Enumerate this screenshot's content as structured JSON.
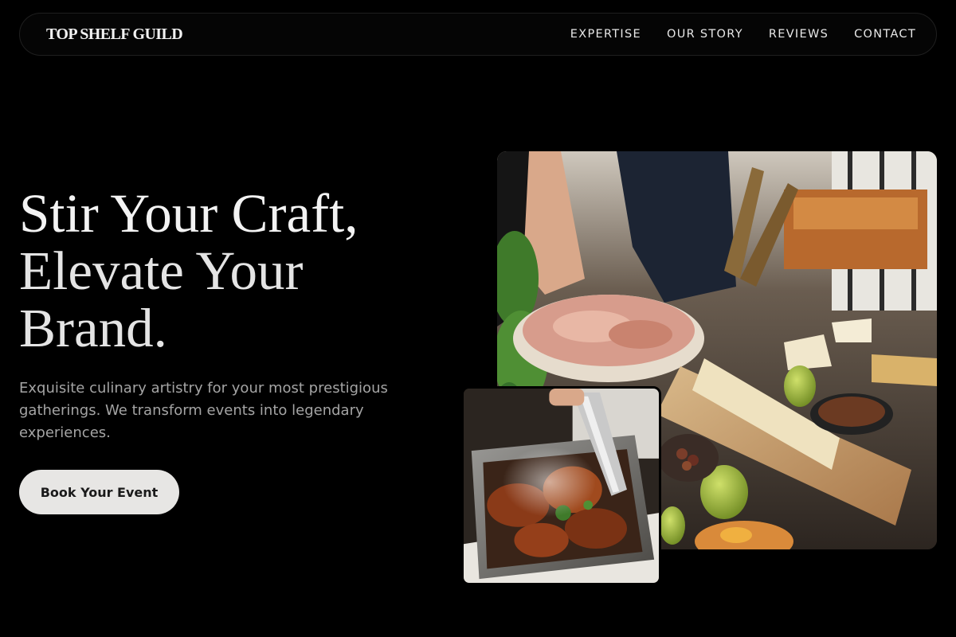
{
  "brand": "TOP SHELF GUILD",
  "nav": {
    "links": [
      "EXPERTISE",
      "OUR STORY",
      "REVIEWS",
      "CONTACT"
    ]
  },
  "hero": {
    "title_lines": [
      "Stir Your Craft,",
      "Elevate Your",
      "Brand."
    ],
    "subtitle": "Exquisite culinary artistry for your most prestigious gatherings. We transform events into legendary experiences.",
    "cta_label": "Book Your Event"
  },
  "images": {
    "main": "catering-spread-photo",
    "secondary": "grilled-food-tongs-photo"
  },
  "colors": {
    "background": "#000000",
    "text": "#f3f3f3",
    "muted_text": "#a4a4a4",
    "cta_background": "#e7e6e4",
    "cta_text": "#1a1a1a"
  }
}
